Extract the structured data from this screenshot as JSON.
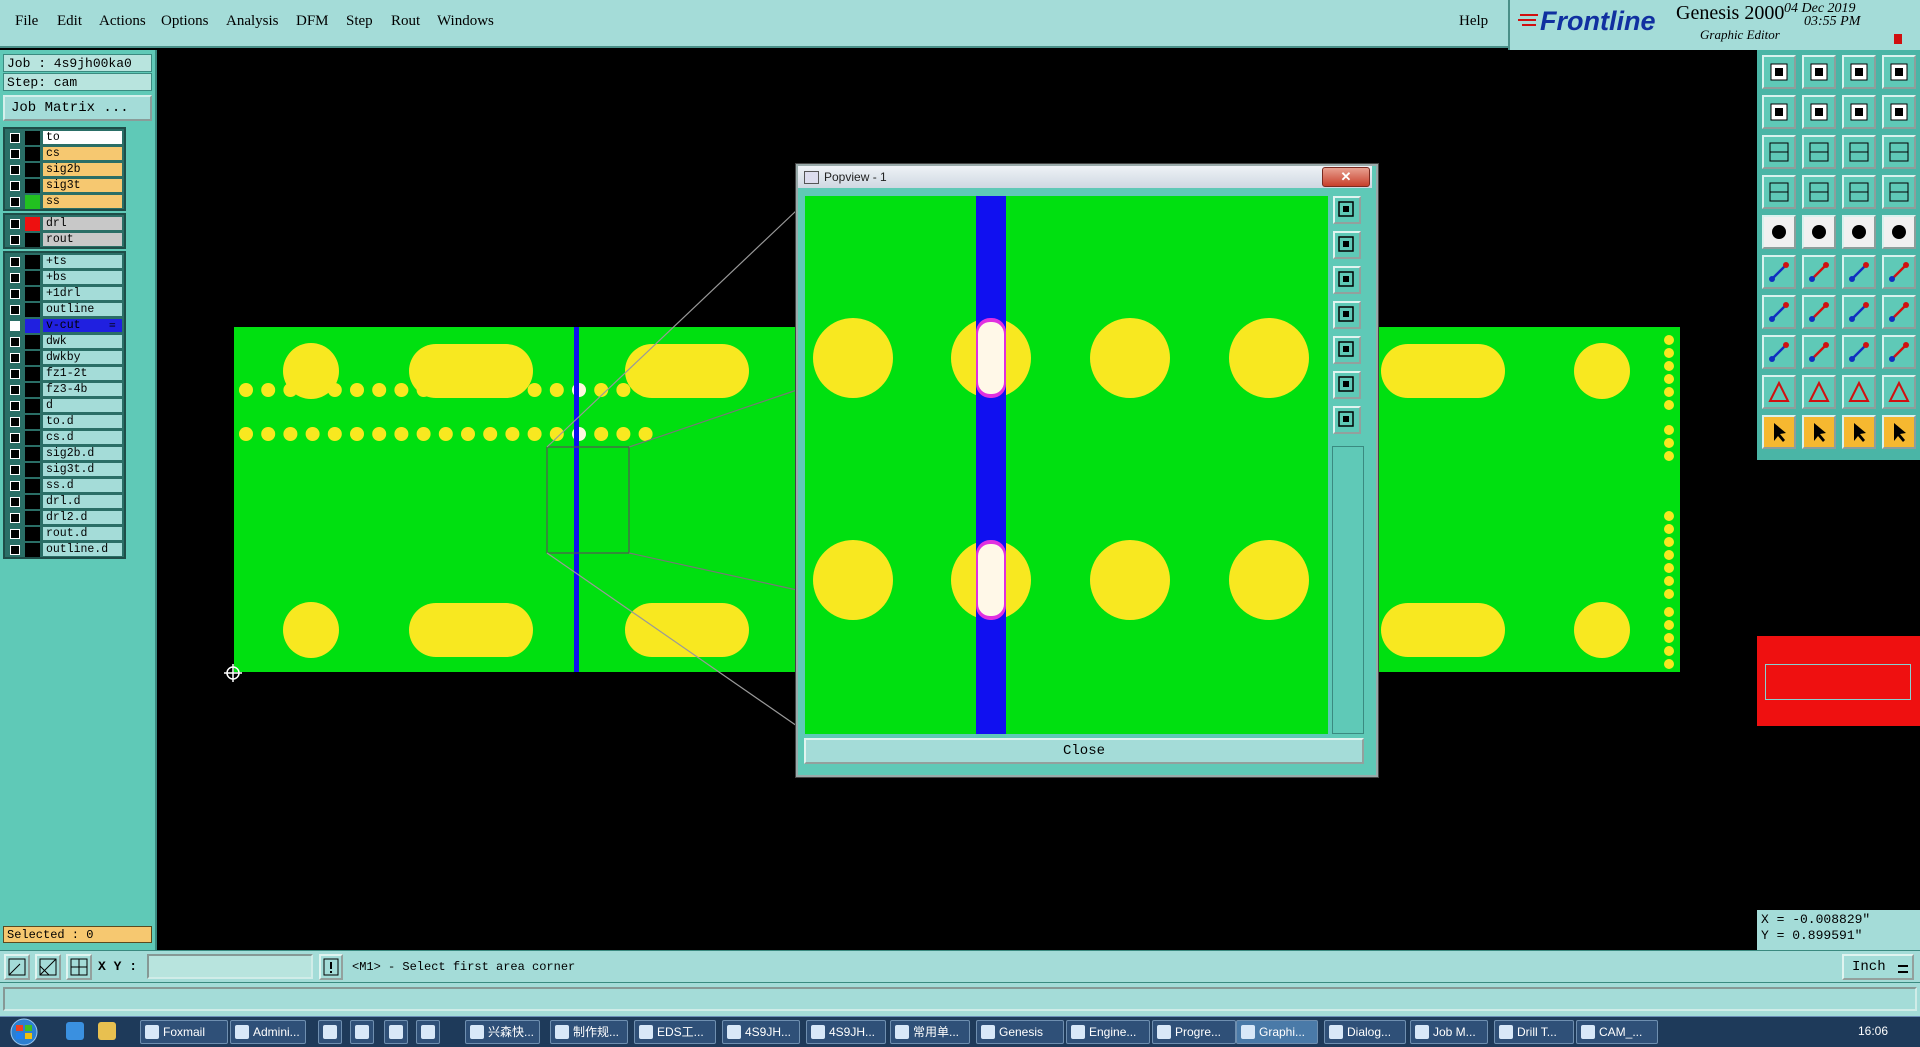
{
  "menubar": {
    "items": [
      "File",
      "Edit",
      "Actions",
      "Options",
      "Analysis",
      "DFM",
      "Step",
      "Rout",
      "Windows"
    ],
    "help": "Help"
  },
  "brand": {
    "logo": "Frontline",
    "product": "Genesis 2000",
    "subtitle": "Graphic Editor",
    "date": "04 Dec 2019",
    "time": "03:55 PM"
  },
  "job": {
    "job_line": "Job : 4s9jh00ka0",
    "step_line": "Step: cam",
    "matrix_button": "Job Matrix ..."
  },
  "layers_board": [
    {
      "name": "to",
      "bg": "#ffffff",
      "swatch": "#000000"
    },
    {
      "name": "cs",
      "bg": "#f6c870",
      "swatch": "#000000"
    },
    {
      "name": "sig2b",
      "bg": "#f6c870",
      "swatch": "#000000"
    },
    {
      "name": "sig3t",
      "bg": "#f6c870",
      "swatch": "#000000"
    },
    {
      "name": "ss",
      "bg": "#f6c870",
      "swatch": "#22c020"
    }
  ],
  "layers_drill": [
    {
      "name": "drl",
      "bg": "#c8c8c8",
      "swatch": "#ee1010"
    },
    {
      "name": "rout",
      "bg": "#c8c8c8",
      "swatch": "#000000"
    }
  ],
  "layers_misc": [
    {
      "name": "+ts",
      "bg": "#a4dcd8",
      "swatch": "#000000"
    },
    {
      "name": "+bs",
      "bg": "#a4dcd8",
      "swatch": "#000000"
    },
    {
      "name": "+1drl",
      "bg": "#a4dcd8",
      "swatch": "#000000"
    },
    {
      "name": "outline",
      "bg": "#a4dcd8",
      "swatch": "#000000"
    },
    {
      "name": "v-cut",
      "bg": "#2020e0",
      "swatch": "#2020e0",
      "mark": "≡",
      "active": true
    },
    {
      "name": "dwk",
      "bg": "#a4dcd8",
      "swatch": "#000000"
    },
    {
      "name": "dwkby",
      "bg": "#a4dcd8",
      "swatch": "#000000"
    },
    {
      "name": "fz1-2t",
      "bg": "#a4dcd8",
      "swatch": "#000000"
    },
    {
      "name": "fz3-4b",
      "bg": "#a4dcd8",
      "swatch": "#000000"
    },
    {
      "name": "d",
      "bg": "#a4dcd8",
      "swatch": "#000000"
    },
    {
      "name": "to.d",
      "bg": "#a4dcd8",
      "swatch": "#000000"
    },
    {
      "name": "cs.d",
      "bg": "#a4dcd8",
      "swatch": "#000000"
    },
    {
      "name": "sig2b.d",
      "bg": "#a4dcd8",
      "swatch": "#000000"
    },
    {
      "name": "sig3t.d",
      "bg": "#a4dcd8",
      "swatch": "#000000"
    },
    {
      "name": "ss.d",
      "bg": "#a4dcd8",
      "swatch": "#000000"
    },
    {
      "name": "drl.d",
      "bg": "#a4dcd8",
      "swatch": "#000000"
    },
    {
      "name": "drl2.d",
      "bg": "#a4dcd8",
      "swatch": "#000000"
    },
    {
      "name": "rout.d",
      "bg": "#a4dcd8",
      "swatch": "#000000"
    },
    {
      "name": "outline.d",
      "bg": "#a4dcd8",
      "swatch": "#000000"
    }
  ],
  "selected": "Selected : 0",
  "popview": {
    "title": "Popview - 1",
    "close_x": "✕",
    "close_button": "Close"
  },
  "coords": {
    "x_line": "X = -0.008829\"",
    "y_line": "Y =  0.899591\""
  },
  "command": {
    "xy_label": "X Y :",
    "xy_value": "",
    "message": "<M1> - Select first area corner",
    "unit": "Inch"
  },
  "taskbar": {
    "items": [
      "Foxmail",
      "Admini...",
      "",
      "",
      "",
      "",
      "兴森快...",
      "制作规...",
      "EDS工...",
      "4S9JH...",
      "4S9JH...",
      "常用单...",
      "Genesis",
      "Engine...",
      "Progre...",
      "Graphi...",
      "Dialog...",
      "Job M...",
      "Drill T...",
      "CAM_..."
    ],
    "clock": "16:06"
  },
  "colors": {
    "board": "#00e010",
    "pad": "#f8e820",
    "vcut": "#1010f0",
    "drill_highlight": "#e030e0"
  }
}
